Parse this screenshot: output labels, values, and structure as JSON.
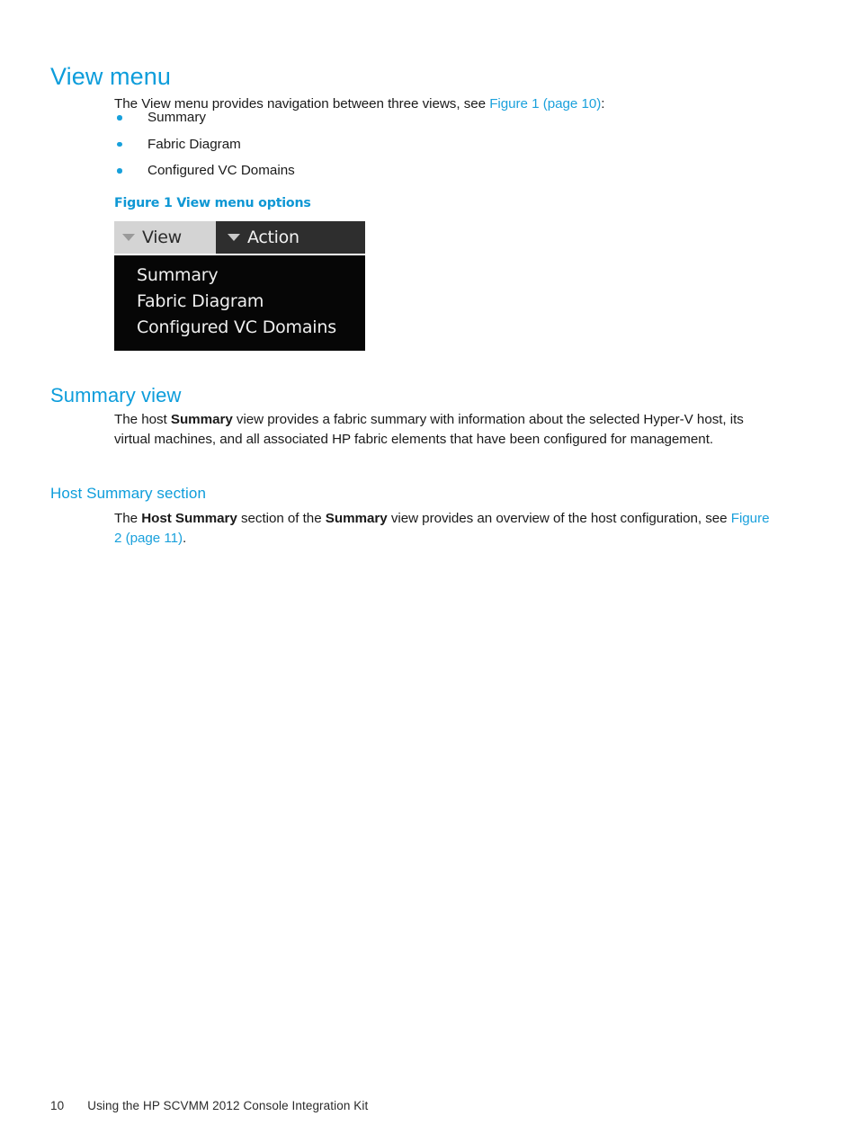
{
  "document": {
    "footer": {
      "page_number": "10",
      "title": "Using the HP SCVMM 2012 Console Integration Kit"
    }
  },
  "colors": {
    "heading_blue": "#0d9ddb",
    "link_blue": "#1ba1dc",
    "caption_blue": "#0e97d4",
    "bullet_blue": "#17a0db",
    "tab_active_bg": "#d4d4d4",
    "tab_inactive_bg": "#2e2e2e",
    "dropdown_bg": "#060606",
    "body_text": "#1a1a1a"
  },
  "sections": {
    "view_menu": {
      "heading": "View menu",
      "intro": {
        "before_link": "The View menu provides navigation between three views, see ",
        "link": "Figure 1 (page 10)",
        "after_link": ":"
      },
      "bullets": [
        "Summary",
        "Fabric Diagram",
        "Configured VC Domains"
      ],
      "figure": {
        "caption": "Figure 1 View menu options",
        "menu_bar": {
          "tabs": [
            {
              "label": "View",
              "state": "active"
            },
            {
              "label": "Action",
              "state": "inactive"
            }
          ]
        },
        "dropdown_items": [
          "Summary",
          "Fabric Diagram",
          "Configured VC Domains"
        ]
      }
    },
    "summary_view": {
      "heading": "Summary view",
      "paragraph": {
        "part1": "The host ",
        "bold1": "Summary",
        "part2": " view provides a fabric summary with information about the selected Hyper-V host, its virtual machines, and all associated HP fabric elements that have been configured for management."
      },
      "host_summary_section": {
        "heading": "Host Summary section",
        "paragraph": {
          "part1": "The ",
          "bold1": "Host Summary",
          "part2": " section of the ",
          "bold2": "Summary",
          "part3": " view provides an overview of the host configuration, see ",
          "link": "Figure 2 (page 11)",
          "part4": "."
        }
      }
    }
  }
}
